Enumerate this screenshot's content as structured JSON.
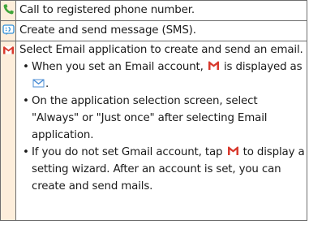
{
  "rows": [
    {
      "icon": "phone-icon",
      "text": "Call to registered phone number."
    },
    {
      "icon": "sms-icon",
      "text": "Create and send message (SMS)."
    },
    {
      "icon": "gmail-icon",
      "text": "Select Email application to create and send an email.",
      "bullets": {
        "b1_pre": "When you set an Email account,",
        "b1_mid": "is displayed as",
        "b1_post": ".",
        "b2": "On the application selection screen, select \"Always\" or \"Just once\" after selecting Email application.",
        "b3_pre": "If you do not set Gmail account, tap",
        "b3_post": "to display a setting wizard. After an account is set, you can create and send mails."
      }
    }
  ],
  "colors": {
    "icon_cell_bg": "#fdeedb",
    "phone_green": "#3fa53a",
    "sms_blue": "#2f8fd8",
    "gmail_red": "#d83a2e",
    "email_blue": "#4d8fd6",
    "border": "#6e6e6e"
  }
}
